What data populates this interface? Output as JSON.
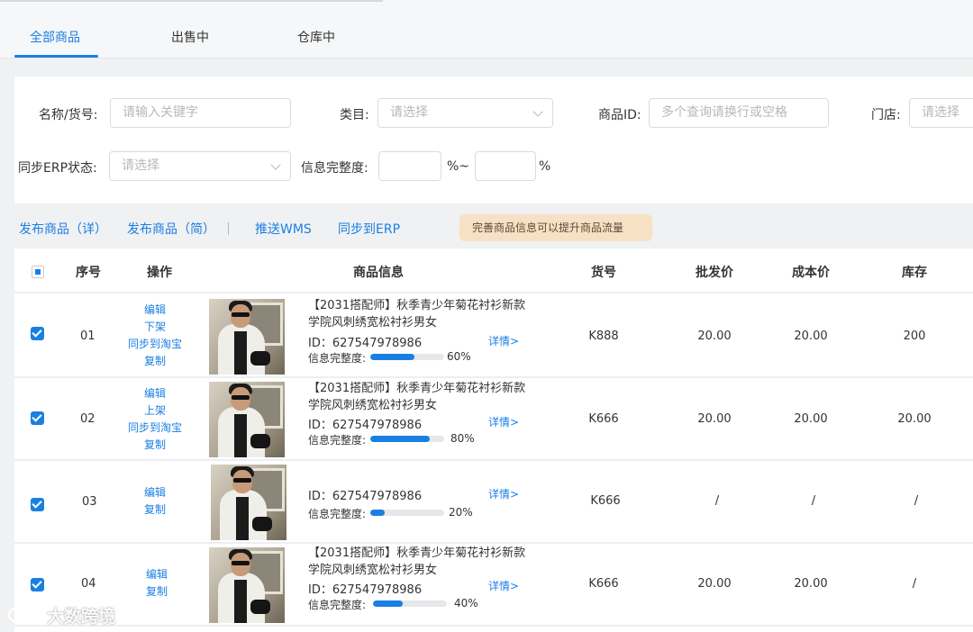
{
  "tabs": [
    {
      "label": "全部商品",
      "active": true
    },
    {
      "label": "出售中",
      "active": false
    },
    {
      "label": "仓库中",
      "active": false
    }
  ],
  "filters": {
    "name_label": "名称/货号:",
    "name_placeholder": "请输入关键字",
    "category_label": "类目:",
    "category_placeholder": "请选择",
    "product_id_label": "商品ID:",
    "product_id_placeholder": "多个查询请换行或空格",
    "store_label": "门店:",
    "store_placeholder": "请选择",
    "erp_status_label": "同步ERP状态:",
    "erp_status_placeholder": "请选择",
    "completeness_label": "信息完整度:",
    "percent_sep": "%~",
    "percent_end": "%"
  },
  "actions": {
    "publish_detailed": "发布商品（详）",
    "publish_simple": "发布商品（简）",
    "push_wms": "推送WMS",
    "sync_erp": "同步到ERP",
    "tip": "完善商品信息可以提升商品流量"
  },
  "table": {
    "columns": {
      "index": "序号",
      "ops": "操作",
      "info": "商品信息",
      "sku": "货号",
      "wholesale": "批发价",
      "cost": "成本价",
      "stock": "库存"
    },
    "rows": [
      {
        "checked": true,
        "index": "01",
        "ops": [
          "编辑",
          "下架",
          "同步到淘宝",
          "复制"
        ],
        "name": "【2031搭配师】秋季青少年菊花衬衫新款学院风刺绣宽松衬衫男女",
        "id": "ID：627547978986",
        "completeness_label": "信息完整度:",
        "completeness": 60,
        "completeness_text": "60%",
        "detail": "详情>",
        "sku": "K888",
        "wholesale": "20.00",
        "cost": "20.00",
        "stock": "200"
      },
      {
        "checked": true,
        "index": "02",
        "ops": [
          "编辑",
          "上架",
          "同步到淘宝",
          "复制"
        ],
        "name": "【2031搭配师】秋季青少年菊花衬衫新款学院风刺绣宽松衬衫男女",
        "id": "ID：627547978986",
        "completeness_label": "信息完整度:",
        "completeness": 80,
        "completeness_text": "80%",
        "detail": "详情>",
        "sku": "K666",
        "wholesale": "20.00",
        "cost": "20.00",
        "stock": "20.00"
      },
      {
        "checked": true,
        "index": "03",
        "ops": [
          "编辑",
          "复制"
        ],
        "name": "",
        "id": "ID：627547978986",
        "completeness_label": "信息完整度:",
        "completeness": 20,
        "completeness_text": "20%",
        "detail": "详情>",
        "sku": "K666",
        "wholesale": "/",
        "cost": "/",
        "stock": "/"
      },
      {
        "checked": true,
        "index": "04",
        "ops": [
          "编辑",
          "复制"
        ],
        "name": "【2031搭配师】秋季青少年菊花衬衫新款学院风刺绣宽松衬衫男女",
        "id": "ID：627547978986",
        "completeness_label": "信息完整度:",
        "completeness": 40,
        "completeness_text": "40%",
        "detail": "详情>",
        "sku": "K666",
        "wholesale": "20.00",
        "cost": "20.00",
        "stock": "/"
      }
    ]
  },
  "watermark": "大数跨境",
  "colors": {
    "accent": "#1a7fe3",
    "tip_bg": "#f7e1c4"
  }
}
